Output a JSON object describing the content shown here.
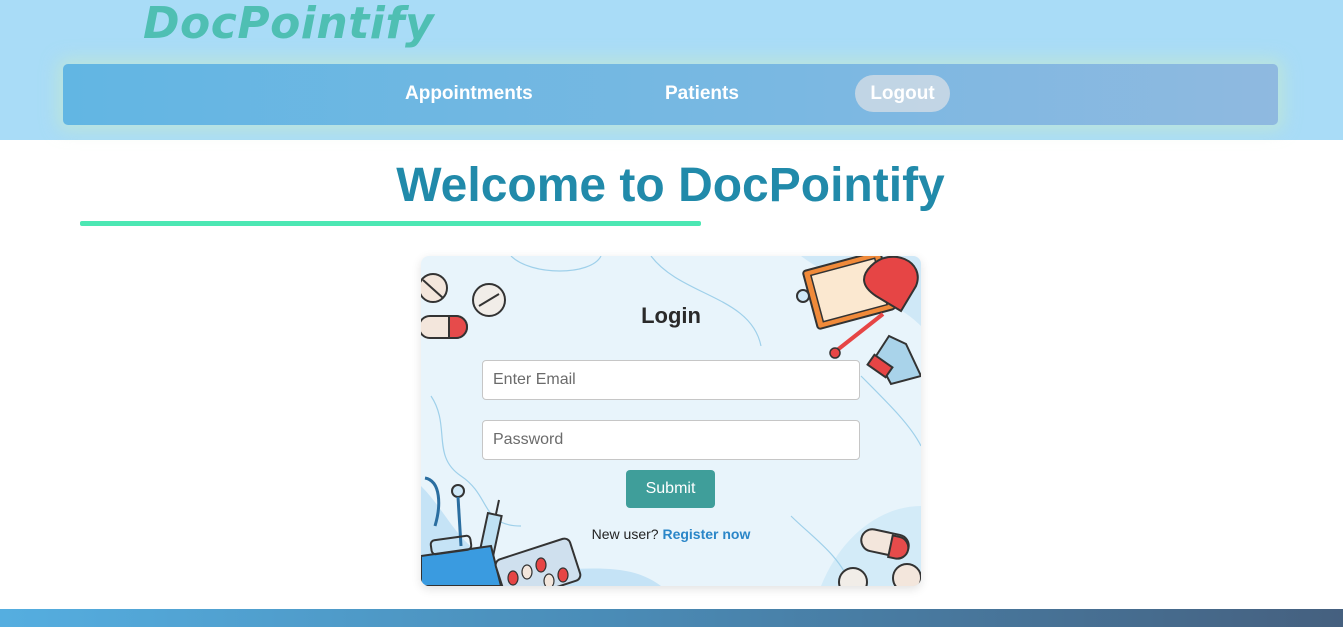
{
  "header": {
    "brand": "DocPointify",
    "nav": {
      "appointments": "Appointments",
      "patients": "Patients",
      "logout": "Logout"
    }
  },
  "main": {
    "title": "Welcome to DocPointify"
  },
  "login": {
    "title": "Login",
    "email_placeholder": "Enter Email",
    "password_placeholder": "Password",
    "submit_label": "Submit",
    "new_user_text": "New user?",
    "register_link": "Register now"
  },
  "colors": {
    "header_bg": "#a9dcf7",
    "brand": "#4fbfb3",
    "title": "#218aaa",
    "accent_underline": "#4ce7b3",
    "submit_bg": "#3f9e9a",
    "link": "#2a86c8"
  }
}
